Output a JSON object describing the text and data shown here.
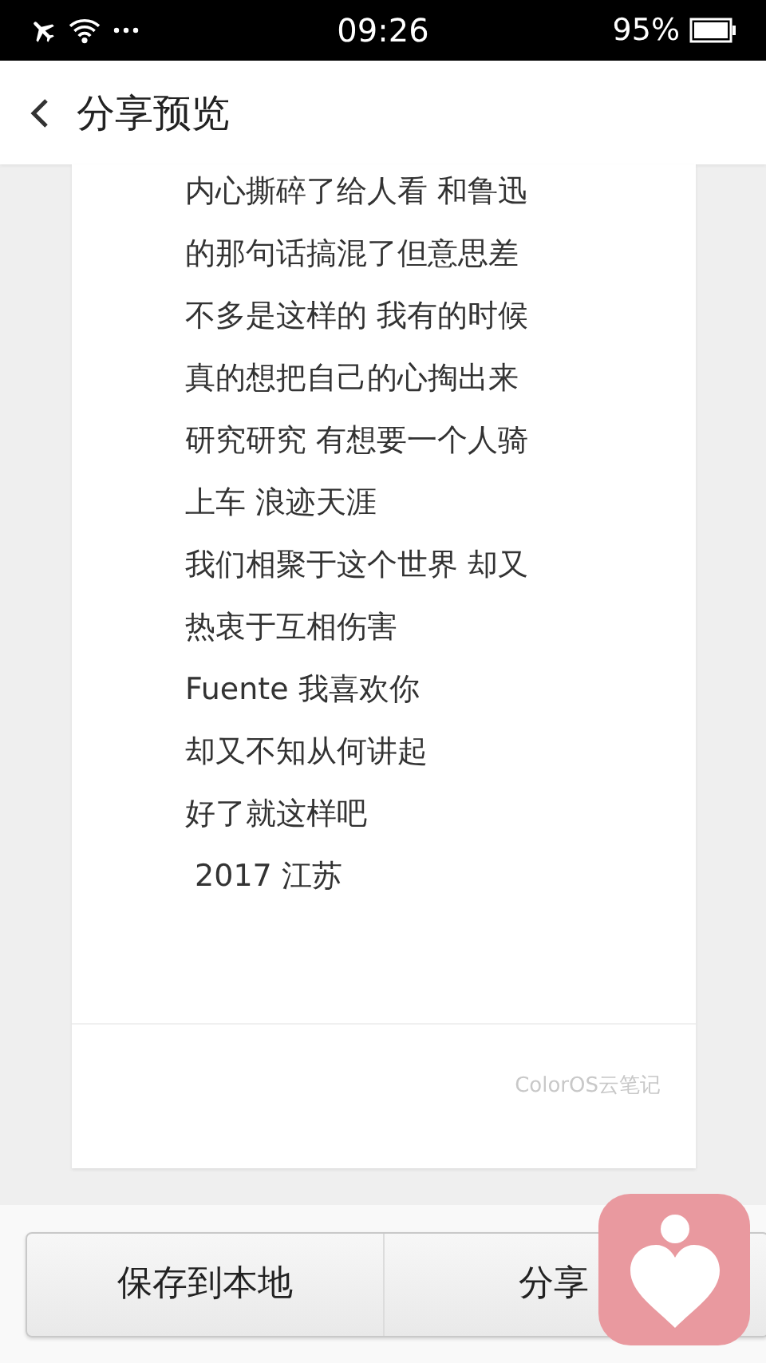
{
  "status_bar": {
    "time": "09:26",
    "battery": "95%"
  },
  "header": {
    "title": "分享预览"
  },
  "note": {
    "lines": [
      "内心撕碎了给人看 和鲁迅",
      "的那句话搞混了但意思差",
      "不多是这样的 我有的时候",
      "真的想把自己的心掏出来",
      "研究研究 有想要一个人骑",
      "上车 浪迹天涯",
      "我们相聚于这个世界 却又",
      "热衷于互相伤害",
      "Fuente 我喜欢你",
      "却又不知从何讲起",
      "好了就这样吧",
      " 2017 江苏"
    ],
    "watermark": "ColorOS云笔记"
  },
  "buttons": [
    "保存到本地",
    "分享"
  ]
}
